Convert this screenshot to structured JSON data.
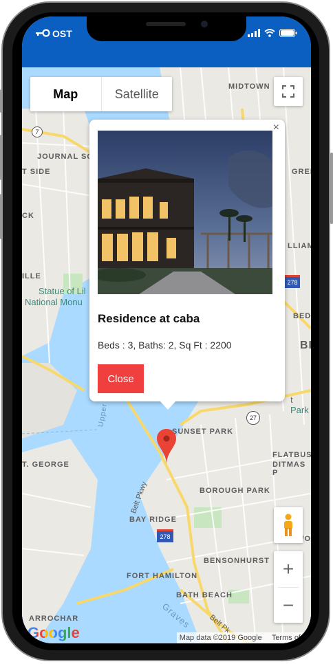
{
  "status_bar": {
    "carrier": "OST"
  },
  "map": {
    "type_control": {
      "map_label": "Map",
      "satellite_label": "Satellite"
    },
    "labels": [
      "MIDTOWN",
      "JOURNAL SQ",
      "T SIDE",
      "GREE",
      "LLIAMS",
      "BEDF",
      "Statue of Lil",
      "National Monu",
      "BI",
      "t Park",
      "Upper",
      "SUNSET PARK",
      "T. GEORGE",
      "FLATBUS",
      "DITMAS P",
      "BOROUGH PARK",
      "Belt Pkwy",
      "BAY RIDGE",
      "MIDWO",
      "BENSONHURST",
      "FORT HAMILTON",
      "BATH BEACH",
      "ARROCHAR",
      "Graves",
      "Belt Pk",
      "278",
      "27",
      "7",
      "ILLE",
      "CK",
      "Li",
      "Sta"
    ],
    "attribution": {
      "data": "Map data ©2019 Google",
      "terms": "Terms of U"
    },
    "zoom_in": "+",
    "zoom_out": "−"
  },
  "popup": {
    "title": "Residence at caba",
    "details": "Beds : 3, Baths: 2, Sq Ft : 2200",
    "close_label": "Close",
    "close_x": "×"
  },
  "branding": {
    "google": "Google"
  },
  "colors": {
    "status_bar": "#0b5fc1",
    "close_button": "#ef3f3f",
    "marker": "#ea4335",
    "water": "#aadaff",
    "land": "#ebe9e4"
  }
}
